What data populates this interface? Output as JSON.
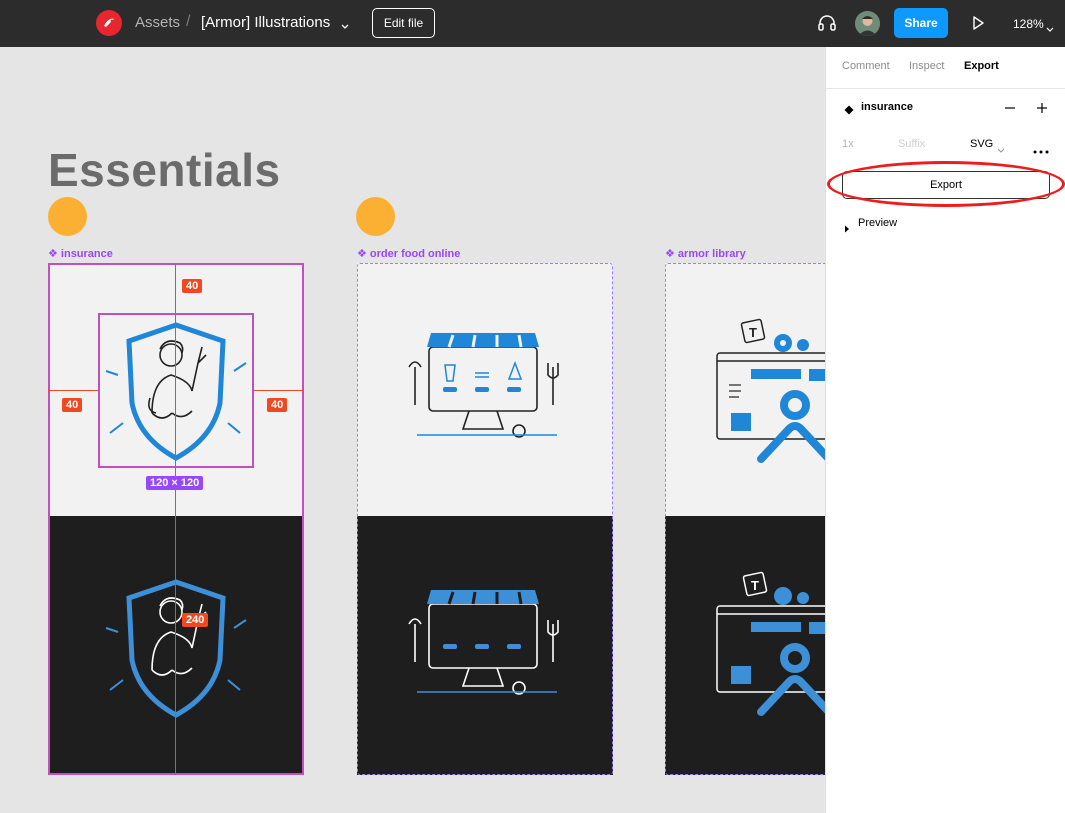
{
  "topbar": {
    "breadcrumb_parent": "Assets",
    "breadcrumb_separator": "/",
    "file_name": "[Armor] Illustrations",
    "edit_file_label": "Edit file",
    "share_label": "Share",
    "zoom_level": "128%"
  },
  "canvas": {
    "page_title": "Essentials",
    "frames": [
      {
        "label": "❖ insurance"
      },
      {
        "label": "❖ order food online"
      },
      {
        "label": "❖ armor library"
      }
    ],
    "measurements": {
      "top": "40",
      "left": "40",
      "right": "40",
      "bottom": "240",
      "size": "120 × 120"
    }
  },
  "panel": {
    "tabs": [
      {
        "label": "Comment"
      },
      {
        "label": "Inspect"
      },
      {
        "label": "Export"
      }
    ],
    "active_tab": "Export",
    "layer_name": "insurance",
    "export_scale": "1x",
    "suffix_placeholder": "Suffix",
    "format": "SVG",
    "export_button_label": "Export",
    "preview_label": "Preview"
  },
  "colors": {
    "topbar_bg": "#2c2c2c",
    "share_blue": "#0d99ff",
    "illustration_blue": "#1f86d8",
    "component_purple": "#9747ff",
    "measure_red": "#f24822",
    "dot_yellow": "#fbb034",
    "highlight_red": "#ee1c1c"
  },
  "icons": [
    "figma-logo-icon",
    "chevron-down-icon",
    "headset-icon",
    "avatar",
    "play-icon",
    "minus-icon",
    "plus-icon",
    "more-icon",
    "caret-right-icon",
    "component-icon"
  ]
}
